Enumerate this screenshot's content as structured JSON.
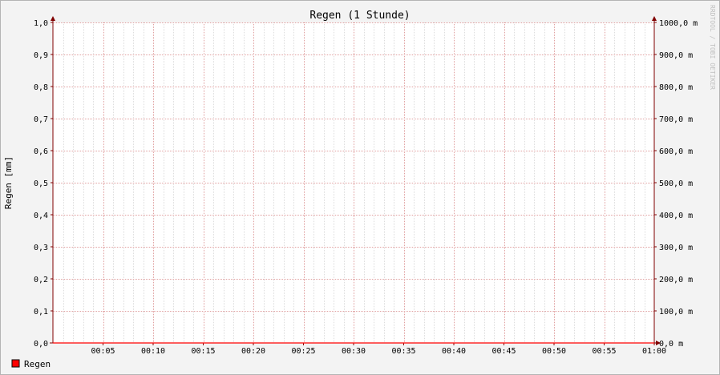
{
  "chart_data": {
    "type": "line",
    "title": "Regen (1 Stunde)",
    "ylabel": "Regen [mm]",
    "ylim": [
      0,
      1
    ],
    "y_ticks": [
      "0,0",
      "0,1",
      "0,2",
      "0,3",
      "0,4",
      "0,5",
      "0,6",
      "0,7",
      "0,8",
      "0,9",
      "1,0"
    ],
    "y2_ticks": [
      "0,0 m",
      "100,0 m",
      "200,0 m",
      "300,0 m",
      "400,0 m",
      "500,0 m",
      "600,0 m",
      "700,0 m",
      "800,0 m",
      "900,0 m",
      "1000,0 m"
    ],
    "x_ticks": [
      "00:05",
      "00:10",
      "00:15",
      "00:20",
      "00:25",
      "00:30",
      "00:35",
      "00:40",
      "00:45",
      "00:50",
      "00:55",
      "01:00"
    ],
    "x_range_minutes": [
      0,
      60
    ],
    "grid": true,
    "legend_position": "bottom-left",
    "series": [
      {
        "name": "Regen",
        "color": "#ff0000",
        "x": [
          "00:00",
          "00:05",
          "00:10",
          "00:15",
          "00:20",
          "00:25",
          "00:30",
          "00:35",
          "00:40",
          "00:45",
          "00:50",
          "00:55",
          "01:00"
        ],
        "values": [
          0,
          0,
          0,
          0,
          0,
          0,
          0,
          0,
          0,
          0,
          0,
          0,
          0
        ]
      }
    ],
    "watermark": "RRDTOOL / TOBI OETIKER"
  },
  "colors": {
    "background": "#f3f3f3",
    "plot_background": "#ffffff",
    "major_grid": "#e0a0a0",
    "minor_grid": "#dddddd",
    "axis": "#800000",
    "frame": "#808080"
  }
}
